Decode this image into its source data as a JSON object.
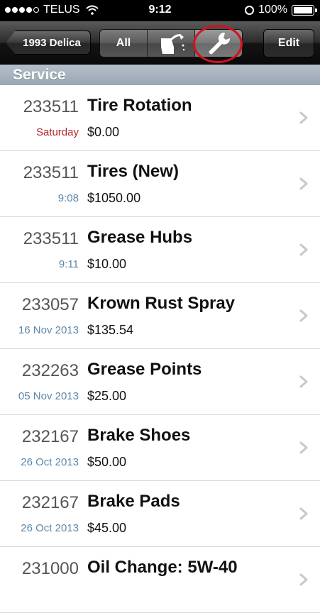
{
  "status_bar": {
    "carrier": "TELUS",
    "time": "9:12",
    "battery": "100%"
  },
  "nav": {
    "back_label": "1993 Delica",
    "segments": [
      {
        "label": "All",
        "icon": "all"
      },
      {
        "label": "",
        "icon": "fuel-pump-icon"
      },
      {
        "label": "",
        "icon": "wrench-icon"
      }
    ],
    "selected_segment": 2,
    "edit_label": "Edit"
  },
  "section_title": "Service",
  "colors": {
    "date_blue": "#5b87a8",
    "date_red": "#b2252a",
    "highlight_ring": "#d3111c"
  },
  "rows": [
    {
      "code": "233511",
      "date": "Saturday",
      "date_style": "red",
      "name": "Tire Rotation",
      "price": "$0.00"
    },
    {
      "code": "233511",
      "date": "9:08",
      "date_style": "blue",
      "name": "Tires (New)",
      "price": "$1050.00"
    },
    {
      "code": "233511",
      "date": "9:11",
      "date_style": "blue",
      "name": "Grease Hubs",
      "price": "$10.00"
    },
    {
      "code": "233057",
      "date": "16 Nov 2013",
      "date_style": "blue",
      "name": "Krown Rust Spray",
      "price": "$135.54"
    },
    {
      "code": "232263",
      "date": "05 Nov 2013",
      "date_style": "blue",
      "name": "Grease Points",
      "price": "$25.00"
    },
    {
      "code": "232167",
      "date": "26 Oct 2013",
      "date_style": "blue",
      "name": "Brake Shoes",
      "price": "$50.00"
    },
    {
      "code": "232167",
      "date": "26 Oct 2013",
      "date_style": "blue",
      "name": "Brake Pads",
      "price": "$45.00"
    },
    {
      "code": "231000",
      "date": "",
      "date_style": "blue",
      "name": "Oil Change: 5W-40",
      "price": ""
    }
  ]
}
